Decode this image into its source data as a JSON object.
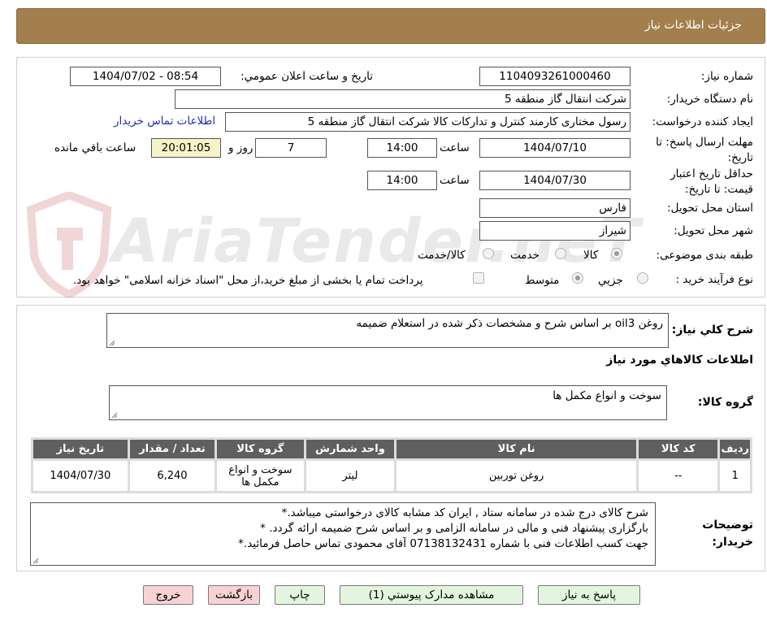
{
  "window_title": "جزئیات اطلاعات نیاز",
  "form": {
    "need_number_label": "شماره نیاز:",
    "need_number": "1104093261000460",
    "announce_label": "تاريخ و ساعت اعلان عمومي:",
    "announce_value": "1404/07/02 - 08:54",
    "buyer_org_label": "نام دستگاه خريدار:",
    "buyer_org": "شركت انتقال گاز منطقه 5",
    "requester_label": "ايجاد كننده درخواست:",
    "requester": "رسول  مختاری کارمند کنترل و تدارکات کالا شركت انتقال گاز منطقه 5",
    "contact_link": "اطلاعات تماس خريدار",
    "deadline_label": "مهلت ارسال پاسخ: تا تاريخ:",
    "deadline_date": "1404/07/10",
    "time_label": "ساعت",
    "deadline_time": "14:00",
    "days_value": "7",
    "days_label": "روز و",
    "countdown": "20:01:05",
    "remaining_label": "ساعت باقي مانده",
    "validity_label": "حداقل تاريخ اعتبار قيمت: تا تاريخ:",
    "validity_date": "1404/07/30",
    "validity_time": "14:00",
    "province_label": "استان محل تحويل:",
    "province": "فارس",
    "city_label": "شهر محل تحويل:",
    "city": "شيراز",
    "category_label": "طبقه بندی موضوعی:",
    "category_options": [
      "كالا",
      "خدمت",
      "كالا/خدمت"
    ],
    "process_label": "نوع فرآيند خريد :",
    "process_options": [
      "جزيي",
      "متوسط"
    ],
    "payment_note": "پرداخت تمام یا بخشی از مبلغ خرید،از محل \"اسناد خزانه اسلامی\" خواهد بود."
  },
  "watermark": "AriaTender.neT",
  "details": {
    "general_label": "شرح كلي نياز:",
    "general_text": "روغن oil3 بر اساس شرح و مشخصات ذکر شده در استعلام ضمیمه",
    "goods_info_heading": "اطلاعات كالاهاي مورد نياز",
    "group_label": "گروه كالا:",
    "group_text": "سوخت و انواع مكمل ها",
    "table": {
      "headers": [
        "رديف",
        "كد كالا",
        "نام كالا",
        "واحد شمارش",
        "گروه كالا",
        "تعداد / مقدار",
        "تاريخ نياز"
      ],
      "rows": [
        [
          "1",
          "--",
          "روغن توربین",
          "لیتر",
          "سوخت و انواع مكمل ها",
          "6,240",
          "1404/07/30"
        ]
      ]
    },
    "buyer_notes_label": "توضيحات خريدار:",
    "buyer_notes": [
      "شرح کالای درج شده در سامانه ستاد , ایران کد مشابه کالای درخواستی میباشد.*",
      "بارگزاری پیشنهاد فنی و مالی در سامانه الزامی و بر اساس شرح ضمیمه ارائه گردد. *",
      "جهت کسب اطلاعات فنی با شماره 07138132431 آقای محمودی تماس حاصل فرمائید.*"
    ]
  },
  "buttons": {
    "reply": "پاسخ به نياز",
    "attachments": "مشاهده مدارک پيوستي (1)",
    "print": "چاپ",
    "back": "بازگشت",
    "exit": "خروج"
  },
  "colors": {
    "title_bar": "#a37f4d",
    "link": "#1a2fb5",
    "button_green": "#e3f5df",
    "button_pink": "#f7d2d4"
  }
}
